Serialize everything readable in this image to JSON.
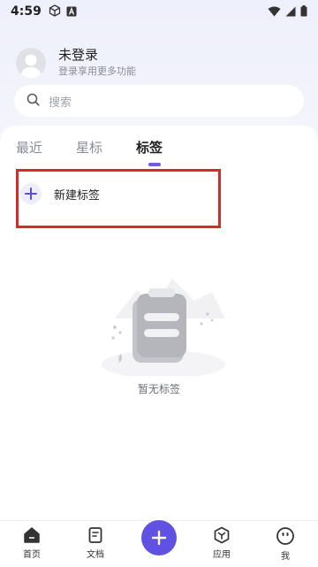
{
  "status_bar": {
    "time": "4:59"
  },
  "user": {
    "name": "未登录",
    "subtitle": "登录享用更多功能"
  },
  "search": {
    "placeholder": "搜索"
  },
  "tabs": [
    {
      "label": "最近",
      "active": false
    },
    {
      "label": "星标",
      "active": false
    },
    {
      "label": "标签",
      "active": true
    }
  ],
  "new_tag": {
    "label": "新建标签"
  },
  "empty_state": {
    "text": "暂无标签"
  },
  "bottom_nav": {
    "items": [
      {
        "label": "首页",
        "icon": "home-icon"
      },
      {
        "label": "文档",
        "icon": "document-icon"
      },
      {
        "label": "",
        "icon": "plus-icon"
      },
      {
        "label": "应用",
        "icon": "apps-icon"
      },
      {
        "label": "我",
        "icon": "smiley-icon"
      }
    ]
  },
  "colors": {
    "accent": "#6151e3",
    "highlight_border": "#d42a2a",
    "tab_indicator": "#6b5fe0"
  }
}
